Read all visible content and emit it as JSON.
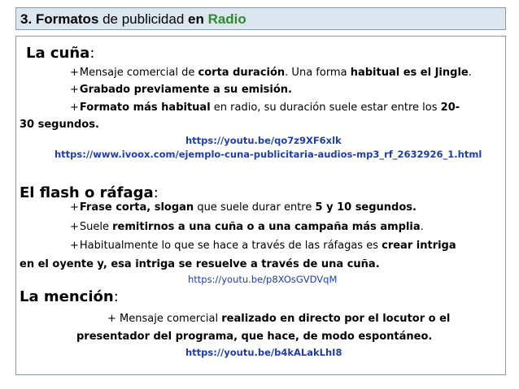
{
  "title": {
    "part1": "3. Formatos",
    "part2": " de publicidad ",
    "part3": "en",
    "part4": " Radio"
  },
  "cuna": {
    "heading": "La cuña",
    "colon": ":",
    "b1_pre": "Mensaje comercial de ",
    "b1_bold": "corta duración",
    "b1_mid": ". Una forma ",
    "b1_bold2": "habitual es el Jingle",
    "b1_end": ".",
    "b2_bold": "Grabado previamente a su emisión.",
    "b3_bold": "Formato más habitual",
    "b3_mid": " en radio, su duración suele estar entre los ",
    "b3_bold2": "20-",
    "b3_cont": "30 segundos.",
    "link1": "https://youtu.be/qo7z9XF6xlk",
    "link2": "https://www.ivoox.com/ejemplo-cuna-publicitaria-audios-mp3_rf_2632926_1.html"
  },
  "flash": {
    "heading": "El flash o ráfaga",
    "colon": ":",
    "b1_bold": "Frase corta, slogan",
    "b1_mid": " que suele durar entre ",
    "b1_bold2": "5 y 10 segundos.",
    "b2_pre": "Suele ",
    "b2_bold": "remitirnos a una cuña o a una campaña más amplia",
    "b2_end": ".",
    "b3_pre": "Habitualmente lo que se hace a través de las ráfagas es ",
    "b3_bold": "crear intriga",
    "b3_cont": "en el oyente y, esa intriga se resuelve a través de una cuña.",
    "link": "https://youtu.be/p8XOsGVDVqM"
  },
  "mencion": {
    "heading": "La mención",
    "colon": ":",
    "b1_pre": "+ Mensaje comercial ",
    "b1_bold": "realizado en directo por el locutor o el",
    "b1_cont": "presentador del programa, que hace, de modo espontáneo.",
    "link": "https://youtu.be/b4kALakLhI8"
  },
  "colors": {
    "title_bg": "#dbe6f1",
    "border": "#7f9cc0",
    "accent_green": "#2e8b2e",
    "link": "#1f3ea8"
  }
}
